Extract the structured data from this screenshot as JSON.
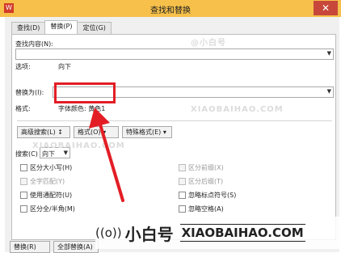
{
  "window": {
    "title": "查找和替换",
    "close_glyph": "✕",
    "app_icon_glyph": "W"
  },
  "tabs": [
    {
      "label": "查找(D)"
    },
    {
      "label": "替换(P)"
    },
    {
      "label": "定位(G)"
    }
  ],
  "find": {
    "label": "查找内容(N):",
    "value": ""
  },
  "options": {
    "label": "选项:",
    "value": "向下"
  },
  "replace": {
    "label": "替换为(I):",
    "value": ""
  },
  "format": {
    "label": "格式:",
    "value": "字体颜色: 黄色1"
  },
  "buttons": {
    "advanced": "高级搜索(L) ↕",
    "format": "格式(O) ▾",
    "special": "特殊格式(E) ▾",
    "replace": "替换(R)",
    "replace_all": "全部替换(A)"
  },
  "search": {
    "label": "搜索(C)",
    "value": "向下"
  },
  "checkboxes_left": [
    {
      "label": "区分大小写(H)",
      "enabled": true
    },
    {
      "label": "全字匹配(Y)",
      "enabled": false
    },
    {
      "label": "使用通配符(U)",
      "enabled": true
    },
    {
      "label": "区分全/半角(M)",
      "enabled": true
    }
  ],
  "checkboxes_right": [
    {
      "label": "区分前缀(X)",
      "enabled": false
    },
    {
      "label": "区分后缀(T)",
      "enabled": false
    },
    {
      "label": "忽略标点符号(S)",
      "enabled": true
    },
    {
      "label": "忽略空格(A)",
      "enabled": true
    }
  ],
  "watermark": {
    "small_cn": "@小白号",
    "small_en": "XIAOBAIHAO.COM",
    "big_cn": "小白号",
    "big_en": "XIAOBAIHAO.COM"
  },
  "colors": {
    "titlebar": "#f6c04a",
    "highlight": "#e31d25",
    "close": "#c7483a"
  }
}
